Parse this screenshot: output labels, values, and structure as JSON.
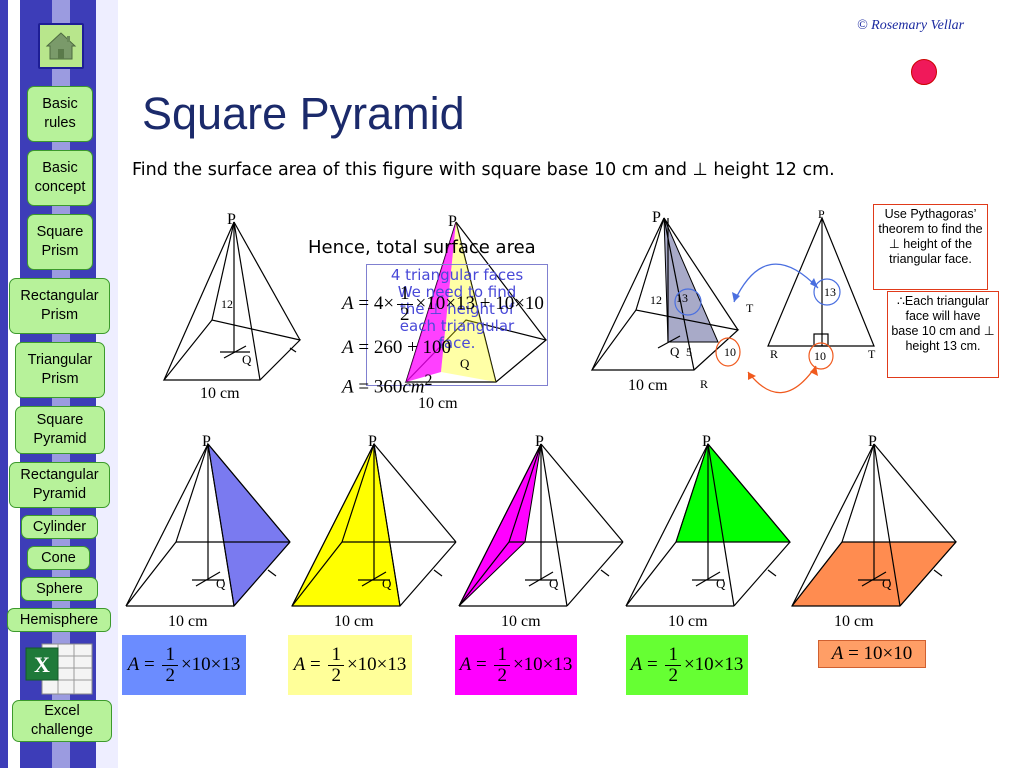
{
  "sidebar": {
    "home_icon": "house-icon",
    "items": [
      {
        "label": "Basic\nrules"
      },
      {
        "label": "Basic\nconcept"
      },
      {
        "label": "Square\nPrism"
      },
      {
        "label": "Rectangular\nPrism"
      },
      {
        "label": "Triangular\nPrism"
      },
      {
        "label": "Square\nPyramid"
      },
      {
        "label": "Rectangular\nPyramid"
      },
      {
        "label": "Cylinder"
      },
      {
        "label": "Cone"
      },
      {
        "label": "Sphere"
      },
      {
        "label": "Hemisphere"
      },
      {
        "label": "Excel\nchallenge"
      }
    ],
    "excel_icon": "excel-icon"
  },
  "credit": "© Rosemary Vellar",
  "title": "Square Pyramid",
  "question": "Find the surface area of this figure with square base 10 cm and ⊥ height 12 cm.",
  "hence": "Hence, total surface area",
  "overlay_note": "4 triangular faces\nWe need to find\nthe ⊥ height of\neach triangular\nface.",
  "formula": {
    "line1": {
      "lhs": "A",
      "mid": "4×",
      "frac_num": "1",
      "frac_den": "2",
      "rest": "×10×13 + 10×10"
    },
    "line2": {
      "lhs": "A",
      "rest": "260 + 100"
    },
    "line3": {
      "lhs": "A",
      "rest": "360",
      "unit": "cm",
      "power": "2"
    }
  },
  "notes": {
    "pythagoras": "Use Pythagoras’ theorem to find the ⊥ height of the triangular face.",
    "each_face": "∴Each triangular face will have base 10 cm and ⊥ height 13 cm."
  },
  "diagram_labels": {
    "apex": "P",
    "center": "Q",
    "height": "12",
    "slant": "13",
    "half_base": "5",
    "base_len": "10",
    "base_label": "10 cm",
    "midpoint": "R",
    "corner": "T"
  },
  "faces": [
    {
      "color": "#7a7af0",
      "box_color": "#6b8cff",
      "area": {
        "lhs": "A",
        "num": "1",
        "den": "2",
        "rest": "×10×13"
      }
    },
    {
      "color": "#ffff00",
      "box_color": "#ffff99",
      "area": {
        "lhs": "A",
        "num": "1",
        "den": "2",
        "rest": "×10×13"
      }
    },
    {
      "color": "#ff00ff",
      "box_color": "#ff00ff",
      "area": {
        "lhs": "A",
        "num": "1",
        "den": "2",
        "rest": "×10×13"
      }
    },
    {
      "color": "#00ff00",
      "box_color": "#66ff33",
      "area": {
        "lhs": "A",
        "num": "1",
        "den": "2",
        "rest": "×10×13"
      }
    },
    {
      "color": "#ff8c50",
      "box_color": "#ff9e66",
      "area": {
        "lhs": "A",
        "rest": "10×10"
      }
    }
  ],
  "colors": {
    "sidebar_dark": "#3d3db8",
    "nav_button": "#b7f29a",
    "title": "#1b2a6b",
    "note_border": "#e03a1a",
    "arrow_blue": "#4a6fe0",
    "arrow_orange": "#f05a1e"
  }
}
